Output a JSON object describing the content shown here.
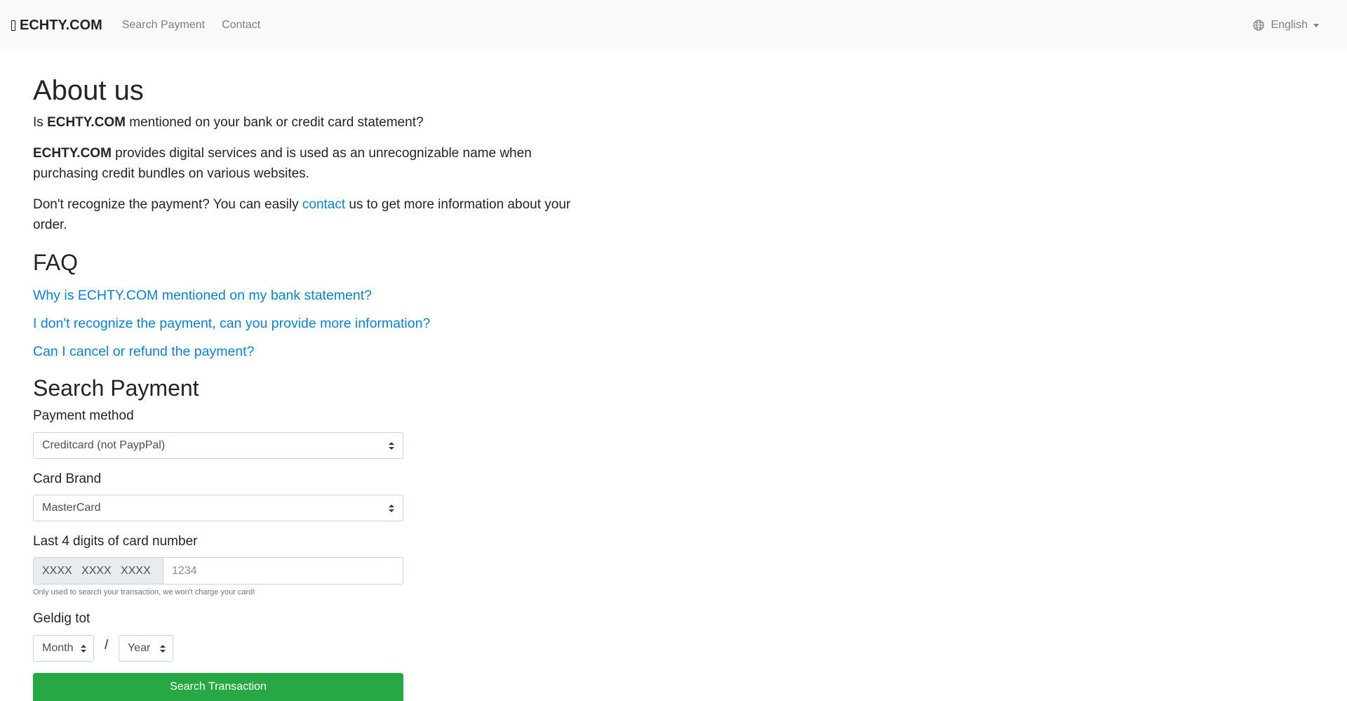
{
  "nav": {
    "brand": "ECHTY.COM",
    "links": [
      "Search Payment",
      "Contact"
    ],
    "language": "English"
  },
  "about": {
    "heading": "About us",
    "q_pre": "Is ",
    "q_brand": "ECHTY.COM",
    "q_post": " mentioned on your bank or credit card statement?",
    "p1_brand": "ECHTY.COM",
    "p1_text": " provides digital services and is used as an unrecognizable name when purchasing credit bundles on various websites.",
    "p2_pre": "Don't recognize the payment? You can easily ",
    "p2_link": "contact",
    "p2_post": " us to get more information about your order."
  },
  "faq": {
    "heading": "FAQ",
    "items": [
      "Why is ECHTY.COM mentioned on my bank statement?",
      "I don't recognize the payment, can you provide more information?",
      "Can I cancel or refund the payment?"
    ]
  },
  "search": {
    "heading": "Search Payment",
    "payment_method_label": "Payment method",
    "payment_method_value": "Creditcard (not PaypPal)",
    "card_brand_label": "Card Brand",
    "card_brand_value": "MasterCard",
    "last4_label": "Last 4 digits of card number",
    "last4_prefix": "XXXX   XXXX   XXXX",
    "last4_placeholder": "1234",
    "last4_help": "Only used to search your transaction, we won't charge your card!",
    "expiry_label": "Geldig tot",
    "month_value": "Month",
    "separator": "/",
    "year_value": "Year",
    "submit_label": "Search Transaction"
  }
}
